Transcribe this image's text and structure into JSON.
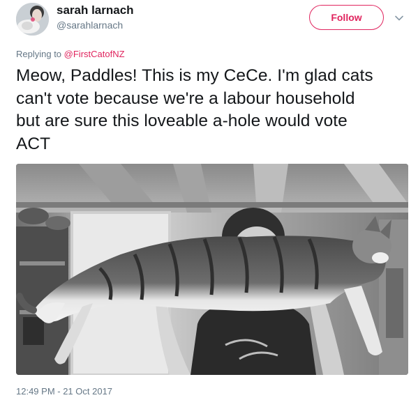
{
  "tweet": {
    "display_name": "sarah larnach",
    "handle": "@sarahlarnach",
    "follow_label": "Follow",
    "reply_prefix": "Replying to",
    "reply_to": "@FirstCatofNZ",
    "text_lines": [
      "Meow, Paddles! This is my CeCe. I'm glad cats",
      "can't vote because we're a labour household",
      "but are sure this loveable a-hole would vote",
      "ACT"
    ],
    "timestamp": "12:49 PM - 21 Oct 2017"
  },
  "colors": {
    "accent": "#e0245e",
    "text": "#14171a",
    "secondary": "#657786"
  },
  "icons": {
    "more": "chevron-down-icon"
  }
}
